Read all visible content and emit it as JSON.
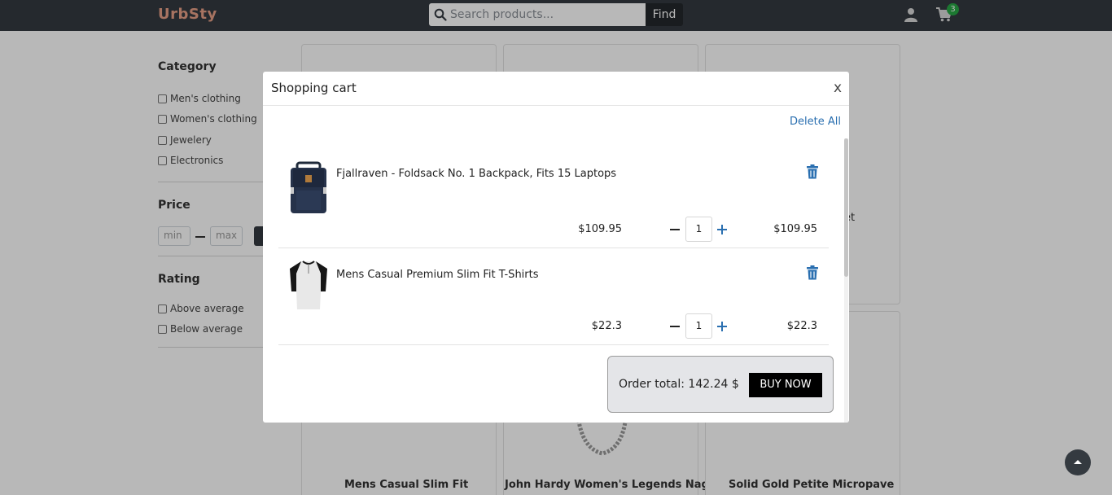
{
  "navbar": {
    "brand": "UrbSty",
    "search_placeholder": "Search products...",
    "find_label": "Find",
    "cart_count": "3"
  },
  "sidebar": {
    "category_heading": "Category",
    "categories": [
      "Men's clothing",
      "Women's clothing",
      "Jewelery",
      "Electronics"
    ],
    "price_heading": "Price",
    "price_min_placeholder": "min",
    "price_max_placeholder": "max",
    "rating_heading": "Rating",
    "ratings": [
      "Above average",
      "Below average"
    ]
  },
  "products": {
    "visible_titles": [
      "Mens Casual Slim Fit",
      "John Hardy Women's Legends Naga",
      "Solid Gold Petite Micropave"
    ],
    "partial_text": "et"
  },
  "cart_modal": {
    "title": "Shopping cart",
    "close_label": "x",
    "delete_all_label": "Delete All",
    "items": [
      {
        "name": "Fjallraven - Foldsack No. 1 Backpack, Fits 15 Laptops",
        "unit_price": "$109.95",
        "quantity": "1",
        "line_total": "$109.95",
        "image_icon": "backpack-image"
      },
      {
        "name": "Mens Casual Premium Slim Fit T-Shirts",
        "unit_price": "$22.3",
        "quantity": "1",
        "line_total": "$22.3",
        "image_icon": "tshirt-image"
      }
    ],
    "order_total_label": "Order total:",
    "order_total_value": "142.24 $",
    "buy_now_label": "BUY NOW"
  },
  "colors": {
    "navbar_bg": "#343a40",
    "brand": "#e8a087",
    "badge": "#28a745",
    "link": "#2a6fb0",
    "trash": "#2a6fb0",
    "buy_button": "#000000"
  }
}
